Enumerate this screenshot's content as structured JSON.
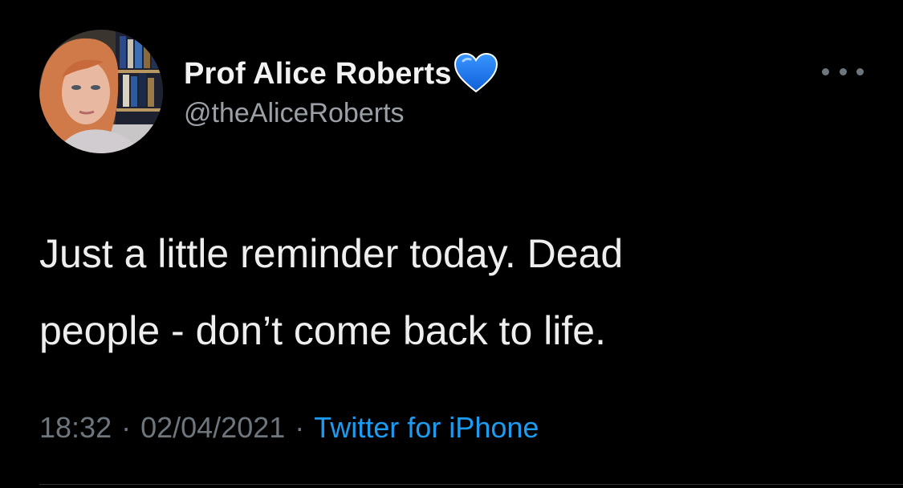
{
  "tweet": {
    "author": {
      "display_name": "Prof Alice Roberts",
      "verified_emoji": "blue-heart-icon",
      "handle": "@theAliceRoberts"
    },
    "text_lines": [
      "Just a little reminder today. Dead",
      "people - don’t come back to life."
    ],
    "time": "18:32",
    "date": "02/04/2021",
    "separator": "·",
    "source": "Twitter for iPhone"
  },
  "colors": {
    "background": "#000000",
    "name": "#f2f2f2",
    "handle": "#9aa0a6",
    "meta": "#6e767d",
    "link": "#1d9bf0",
    "heart": "#1a7bf2"
  }
}
